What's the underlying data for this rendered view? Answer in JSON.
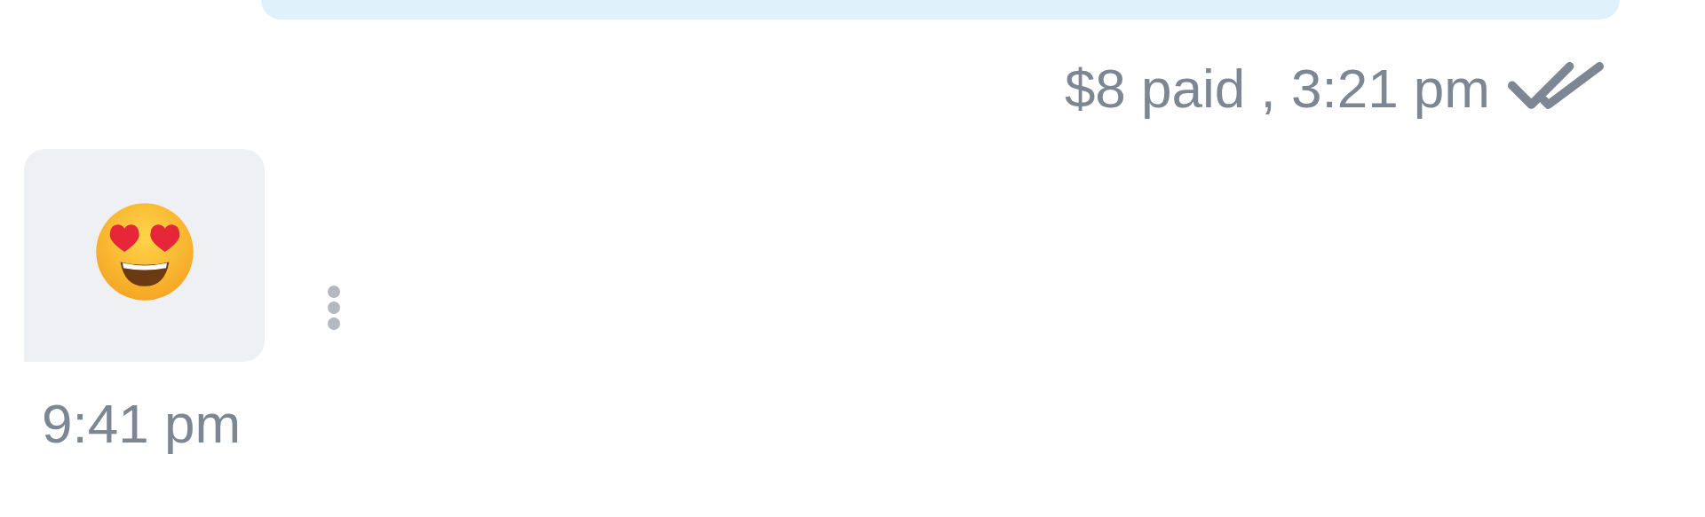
{
  "messages": [
    {
      "kind": "outgoing",
      "meta": "$8 paid , 3:21 pm",
      "read": true
    },
    {
      "kind": "emoji",
      "time": "9:41 pm"
    }
  ]
}
